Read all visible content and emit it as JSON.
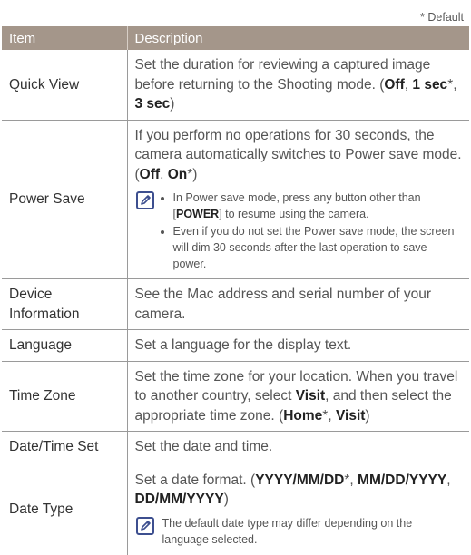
{
  "default_note": "* Default",
  "header": {
    "item": "Item",
    "description": "Description"
  },
  "rows": [
    {
      "item": "Quick View",
      "d1": "Set the duration for reviewing a captured image before returning to the Shooting mode. (",
      "off": "Off",
      "sep1": ", ",
      "one_sec": "1 sec",
      "star1": "*",
      "sep2": ", ",
      "three_sec": "3 sec",
      "close": ")"
    },
    {
      "item": "Power Save",
      "d1": "If you perform no operations for 30 seconds, the camera automatically switches to Power save mode. (",
      "off": "Off",
      "sep1": ", ",
      "on": "On",
      "star1": "*",
      "close": ")",
      "note1a": "In Power save mode, press any button other than [",
      "power": "POWER",
      "note1b": "] to resume using the camera.",
      "note2": "Even if you do not set the Power save mode, the screen will dim 30 seconds after the last operation to save power."
    },
    {
      "item_l1": "Device",
      "item_l2": "Information",
      "desc": "See the Mac address and serial number of your camera."
    },
    {
      "item": "Language",
      "desc": "Set a language for the display text."
    },
    {
      "item": "Time Zone",
      "d1": "Set the time zone for your location. When you travel to another country, select ",
      "visit": "Visit",
      "d2": ", and then select the appropriate time zone. (",
      "home": "Home",
      "star1": "*",
      "sep1": ", ",
      "visit2": "Visit",
      "close": ")"
    },
    {
      "item": "Date/Time Set",
      "desc": "Set the date and time."
    },
    {
      "item": "Date Type",
      "d1": "Set a date format. (",
      "f1": "YYYY/MM/DD",
      "star1": "*",
      "sep1": ", ",
      "f2": "MM/DD/YYYY",
      "sep2": ", ",
      "f3": "DD/MM/YYYY",
      "close": ")",
      "note": "The default date type may differ depending on the language selected."
    }
  ],
  "icons": {
    "note": "note-pencil-icon"
  },
  "colors": {
    "header_bg": "#a4968a",
    "note_icon": "#3d4f8f"
  }
}
